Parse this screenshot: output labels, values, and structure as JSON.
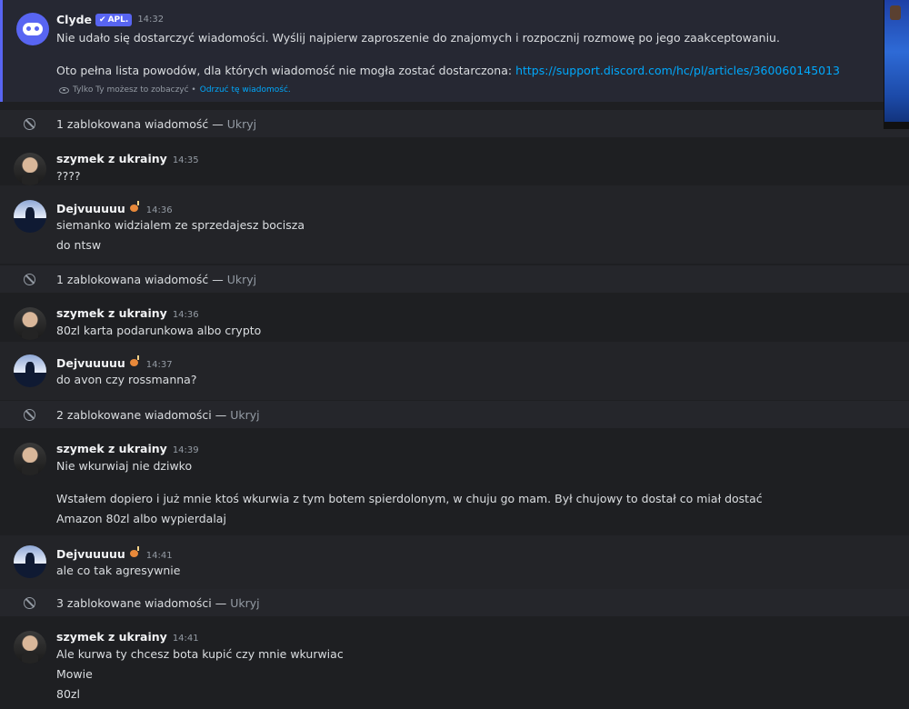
{
  "clyde": {
    "name": "Clyde",
    "badge": "APL.",
    "time": "14:32",
    "line1": "Nie udało się dostarczyć wiadomości. Wyślij najpierw zaproszenie do znajomych i rozpocznij rozmowę po jego zaakceptowaniu.",
    "line2_prefix": "Oto pełna lista powodów, dla których wiadomość nie mogła zostać dostarczona: ",
    "link": "https://support.discord.com/hc/pl/articles/360060145013",
    "ephemeral_note": "Tylko Ty możesz to zobaczyć •",
    "dismiss": "Odrzuć tę wiadomość."
  },
  "blocked": [
    {
      "text": "1 zablokowana wiadomość — ",
      "hide": "Ukryj"
    },
    {
      "text": "1 zablokowana wiadomość — ",
      "hide": "Ukryj"
    },
    {
      "text": "2 zablokowane wiadomości — ",
      "hide": "Ukryj"
    },
    {
      "text": "3 zablokowane wiadomości — ",
      "hide": "Ukryj"
    }
  ],
  "messages": [
    {
      "author": "szymek z ukrainy",
      "time": "14:35",
      "lines": [
        "????"
      ]
    },
    {
      "author": "Dejvuuuuu",
      "time": "14:36",
      "lines": [
        "siemanko widzialem ze sprzedajesz bocisza",
        "do ntsw"
      ]
    },
    {
      "author": "szymek z ukrainy",
      "time": "14:36",
      "lines": [
        "80zl karta podarunkowa albo crypto"
      ]
    },
    {
      "author": "Dejvuuuuu",
      "time": "14:37",
      "lines": [
        "do avon czy rossmanna?"
      ]
    },
    {
      "author": "szymek z ukrainy",
      "time": "14:39",
      "lines": [
        "Nie wkurwiaj nie dziwko",
        "Wstałem dopiero i już mnie ktoś wkurwia z tym botem spierdolonym, w chuju go mam. Był chujowy to dostał co miał dostać",
        "Amazon 80zl albo wypierdalaj"
      ]
    },
    {
      "author": "Dejvuuuuu",
      "time": "14:41",
      "lines": [
        "ale co tak agresywnie"
      ]
    },
    {
      "author": "szymek z ukrainy",
      "time": "14:41",
      "lines": [
        "Ale kurwa ty chcesz bota kupić czy mnie wkurwiac",
        "Mowie",
        "80zl"
      ]
    }
  ]
}
